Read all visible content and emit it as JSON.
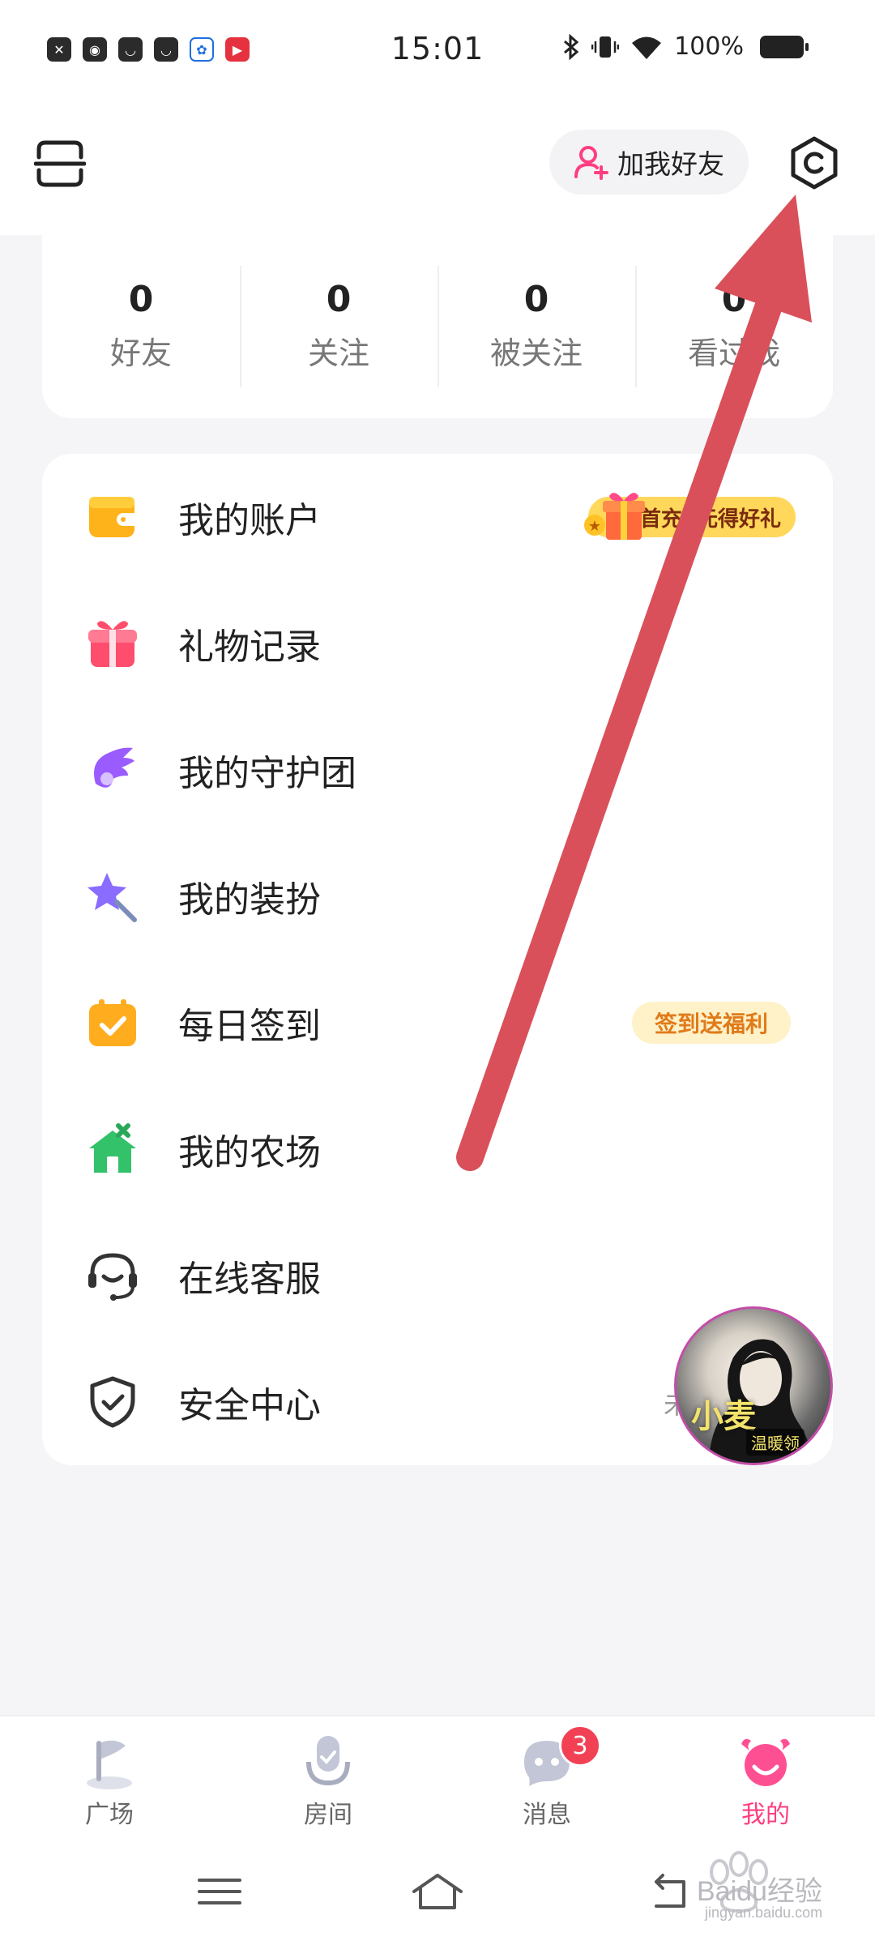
{
  "status_bar": {
    "time": "15:01",
    "battery": "100%",
    "notification_icons": [
      "close-app-icon",
      "app-icon",
      "app-icon",
      "app-icon",
      "baidu-app-icon",
      "video-app-icon"
    ]
  },
  "header": {
    "add_friend_label": "加我好友",
    "accent_color": "#ff3d7f"
  },
  "stats": [
    {
      "value": "0",
      "label": "好友"
    },
    {
      "value": "0",
      "label": "关注"
    },
    {
      "value": "0",
      "label": "被关注"
    },
    {
      "value": "0",
      "label": "看过我"
    }
  ],
  "menu": [
    {
      "label": "我的账户",
      "icon": "wallet-icon",
      "badge": "首充1元得好礼"
    },
    {
      "label": "礼物记录",
      "icon": "gift-icon"
    },
    {
      "label": "我的守护团",
      "icon": "wing-icon"
    },
    {
      "label": "我的装扮",
      "icon": "star-wand-icon"
    },
    {
      "label": "每日签到",
      "icon": "calendar-check-icon",
      "badge": "签到送福利"
    },
    {
      "label": "我的农场",
      "icon": "farm-house-icon"
    },
    {
      "label": "在线客服",
      "icon": "headset-icon"
    },
    {
      "label": "安全中心",
      "icon": "shield-check-icon",
      "status": "未实名"
    }
  ],
  "floating_avatar": {
    "caption": "小麦",
    "tag": "温暖领"
  },
  "tabs": [
    {
      "label": "广场",
      "icon": "flag-icon",
      "active": false
    },
    {
      "label": "房间",
      "icon": "microphone-icon",
      "active": false
    },
    {
      "label": "消息",
      "icon": "chat-bubble-icon",
      "active": false,
      "badge": "3"
    },
    {
      "label": "我的",
      "icon": "crab-face-icon",
      "active": true
    }
  ],
  "watermark": {
    "brand": "Baidu经验",
    "url": "jingyan.baidu.com"
  }
}
